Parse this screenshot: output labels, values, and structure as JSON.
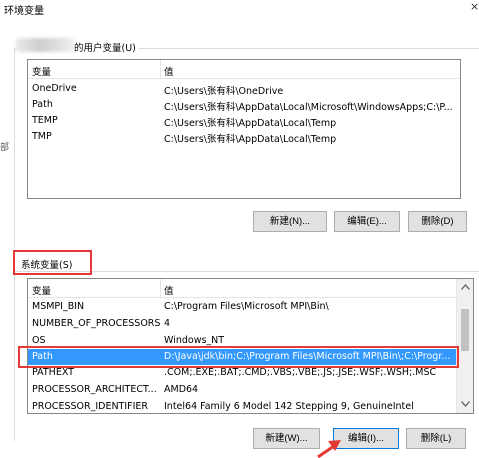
{
  "window": {
    "title": "环境变量",
    "close_label": "×",
    "edge_glyph": "部"
  },
  "user_vars": {
    "legend": "的用户变量(U)",
    "columns": [
      "变量",
      "值"
    ],
    "rows": [
      {
        "name": "OneDrive",
        "value": "C:\\Users\\张有科\\OneDrive"
      },
      {
        "name": "Path",
        "value": "C:\\Users\\张有科\\AppData\\Local\\Microsoft\\WindowsApps;C:\\P..."
      },
      {
        "name": "TEMP",
        "value": "C:\\Users\\张有科\\AppData\\Local\\Temp"
      },
      {
        "name": "TMP",
        "value": "C:\\Users\\张有科\\AppData\\Local\\Temp"
      }
    ],
    "buttons": {
      "new": "新建(N)...",
      "edit": "编辑(E)...",
      "delete": "删除(D)"
    }
  },
  "sys_vars": {
    "legend": "系统变量(S)",
    "columns": [
      "变量",
      "值"
    ],
    "rows": [
      {
        "name": "MSMPI_BIN",
        "value": "C:\\Program Files\\Microsoft MPI\\Bin\\"
      },
      {
        "name": "NUMBER_OF_PROCESSORS",
        "value": "4"
      },
      {
        "name": "OS",
        "value": "Windows_NT"
      },
      {
        "name": "Path",
        "value": "D:\\Java\\jdk\\bin;C:\\Program Files\\Microsoft MPI\\Bin\\;C:\\Progr..."
      },
      {
        "name": "PATHEXT",
        "value": ".COM;.EXE;.BAT;.CMD;.VBS;.VBE;.JS;.JSE;.WSF;.WSH;.MSC"
      },
      {
        "name": "PROCESSOR_ARCHITECT...",
        "value": "AMD64"
      },
      {
        "name": "PROCESSOR_IDENTIFIER",
        "value": "Intel64 Family 6 Model 142 Stepping 9, GenuineIntel"
      }
    ],
    "selected_row": "Path",
    "buttons": {
      "new": "新建(W)...",
      "edit": "编辑(I)...",
      "delete": "删除(L)"
    }
  },
  "scroll_icons": {
    "up": "up-arrow-icon",
    "down": "down-arrow-icon"
  },
  "colors": {
    "selection": "#3399ff",
    "annotation": "#e53935",
    "focus_border": "#0078d7",
    "button_bg": "#e1e1e1"
  }
}
